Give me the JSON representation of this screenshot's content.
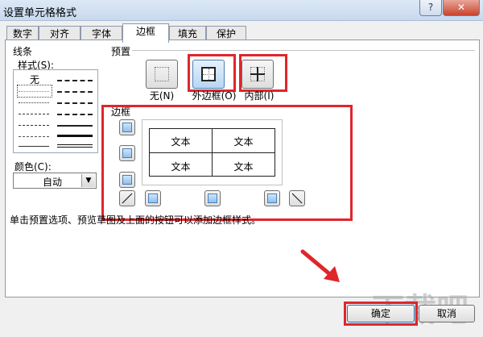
{
  "window": {
    "title": "设置单元格格式",
    "help_label": "?",
    "close_label": "✕"
  },
  "tabs": [
    {
      "label": "数字"
    },
    {
      "label": "对齐"
    },
    {
      "label": "字体"
    },
    {
      "label": "边框"
    },
    {
      "label": "填充"
    },
    {
      "label": "保护"
    }
  ],
  "line": {
    "group_label": "线条",
    "style_label": "样式(S):",
    "none_label": "无",
    "color_label": "颜色(C):",
    "color_value": "自动"
  },
  "presets": {
    "group_label": "预置",
    "items": [
      {
        "label": "无(N)",
        "icon": "border-none-icon"
      },
      {
        "label": "外边框(O)",
        "icon": "border-outline-icon"
      },
      {
        "label": "内部(I)",
        "icon": "border-inside-icon"
      }
    ]
  },
  "border": {
    "group_label": "边框",
    "preview_cells": [
      "文本",
      "文本",
      "文本",
      "文本"
    ]
  },
  "hint": "单击预置选项、预览草图及上面的按钮可以添加边框样式。",
  "footer": {
    "ok_label": "确定",
    "cancel_label": "取消"
  },
  "watermark": "下载吧",
  "colors": {
    "highlight": "#e0252b",
    "accent": "#4a7fb8"
  }
}
